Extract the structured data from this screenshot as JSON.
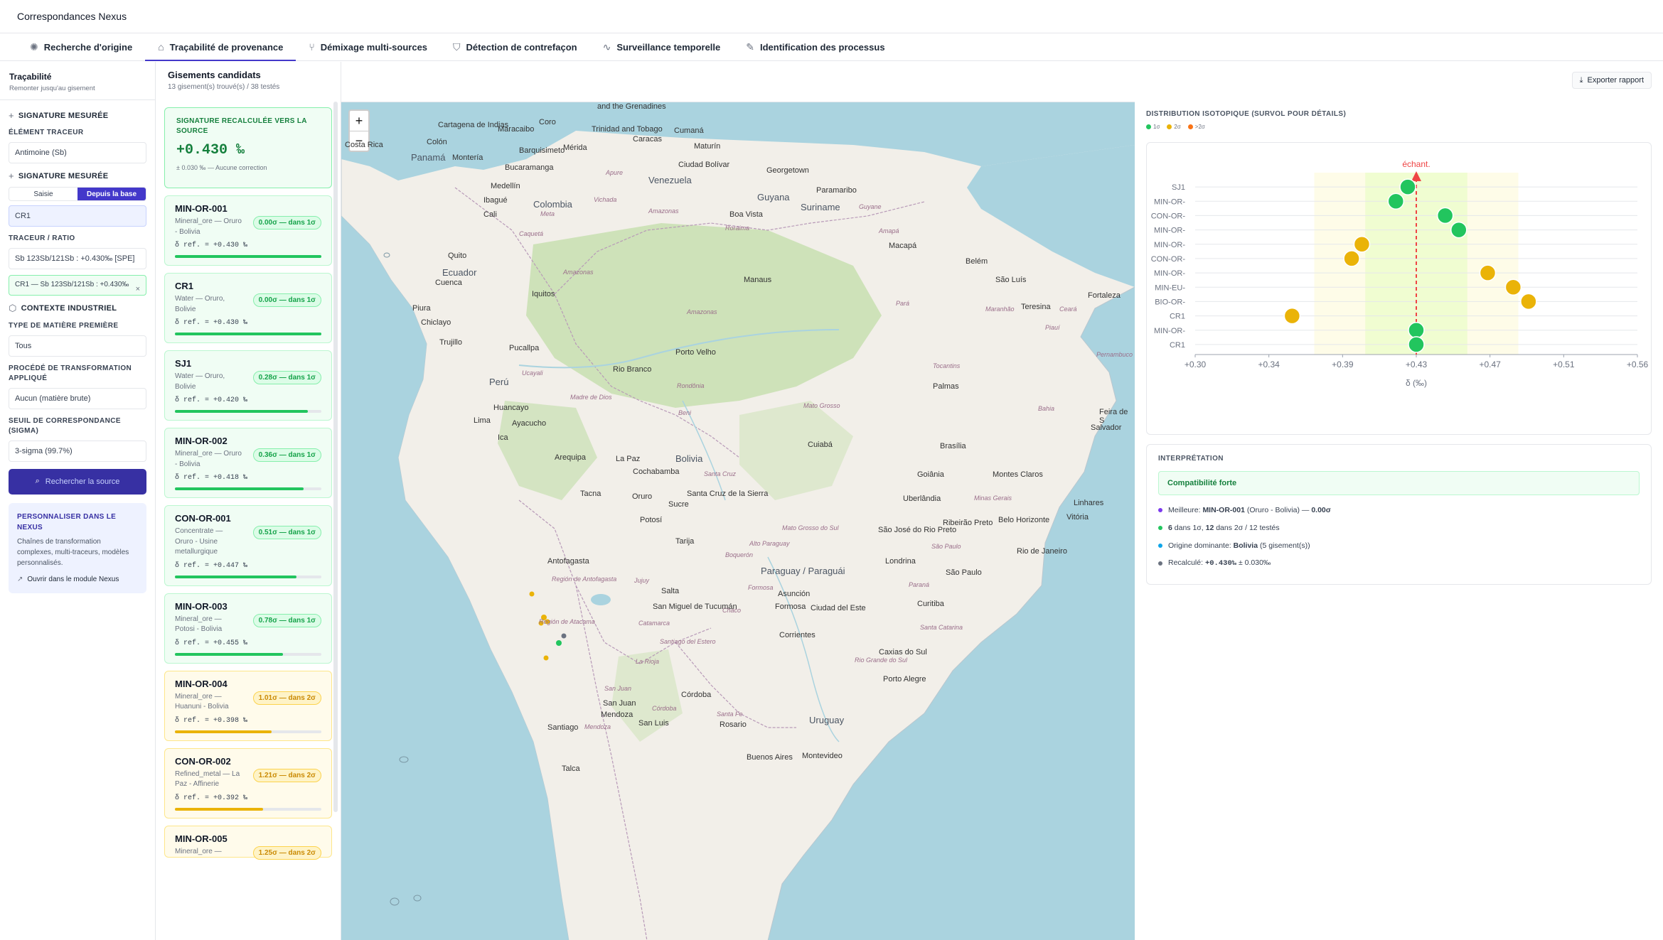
{
  "app": {
    "title": "Correspondances Nexus"
  },
  "tabs": [
    {
      "label": "Recherche d'origine",
      "icon": "sun-icon"
    },
    {
      "label": "Traçabilité de provenance",
      "icon": "home-icon"
    },
    {
      "label": "Démixage multi-sources",
      "icon": "split-icon"
    },
    {
      "label": "Détection de contrefaçon",
      "icon": "shield-icon"
    },
    {
      "label": "Surveillance temporelle",
      "icon": "pulse-icon"
    },
    {
      "label": "Identification des processus",
      "icon": "wrench-icon"
    }
  ],
  "left": {
    "title": "Traçabilité",
    "subtitle": "Remonter jusqu'au gisement",
    "sig1_header": "SIGNATURE MESURÉE",
    "element_label": "ÉLÉMENT TRACEUR",
    "element_value": "Antimoine (Sb)",
    "sig2_header": "SIGNATURE MESURÉE",
    "toggle_manual": "Saisie",
    "toggle_db": "Depuis la base",
    "sample_value": "CR1",
    "ratio_label": "TRACEUR / RATIO",
    "ratio_value": "Sb 123Sb/121Sb : +0.430‰ [SPE]",
    "chip_text": "CR1 — Sb 123Sb/121Sb : +0.430‰",
    "ctx_header": "CONTEXTE INDUSTRIEL",
    "material_label": "TYPE DE MATIÈRE PREMIÈRE",
    "material_value": "Tous",
    "process_label": "PROCÉDÉ DE TRANSFORMATION APPLIQUÉ",
    "process_value": "Aucun (matière brute)",
    "threshold_label": "SEUIL DE CORRESPONDANCE (SIGMA)",
    "threshold_value": "3-sigma (99.7%)",
    "search_button": "Rechercher la source",
    "custom_title": "PERSONNALISER DANS LE NEXUS",
    "custom_text": "Chaînes de transformation complexes, multi-traceurs, modèles personnalisés.",
    "custom_link": "Ouvrir dans le module Nexus"
  },
  "candidates": {
    "title": "Gisements candidats",
    "subtitle": "13 gisement(s) trouvé(s) / 38 testés",
    "signature": {
      "title": "SIGNATURE RECALCULÉE VERS LA SOURCE",
      "value": "+0.430 ‰",
      "sub": "± 0.030 ‰ — Aucune correction"
    },
    "cards": [
      {
        "id": "MIN-OR-001",
        "desc": "Mineral_ore — Oruro - Bolivia",
        "badge": "0.00σ — dans 1σ",
        "ref": "δ ref. = +0.430 ‰",
        "score": 1.0,
        "level": "g"
      },
      {
        "id": "CR1",
        "desc": "Water — Oruro, Bolivie",
        "badge": "0.00σ — dans 1σ",
        "ref": "δ ref. = +0.430 ‰",
        "score": 1.0,
        "level": "g"
      },
      {
        "id": "SJ1",
        "desc": "Water — Oruro, Bolivie",
        "badge": "0.28σ — dans 1σ",
        "ref": "δ ref. = +0.420 ‰",
        "score": 0.91,
        "level": "g"
      },
      {
        "id": "MIN-OR-002",
        "desc": "Mineral_ore — Oruro - Bolivia",
        "badge": "0.36σ — dans 1σ",
        "ref": "δ ref. = +0.418 ‰",
        "score": 0.88,
        "level": "g"
      },
      {
        "id": "CON-OR-001",
        "desc": "Concentrate — Oruro - Usine metallurgique",
        "badge": "0.51σ — dans 1σ",
        "ref": "δ ref. = +0.447 ‰",
        "score": 0.83,
        "level": "g"
      },
      {
        "id": "MIN-OR-003",
        "desc": "Mineral_ore — Potosi - Bolivia",
        "badge": "0.78σ — dans 1σ",
        "ref": "δ ref. = +0.455 ‰",
        "score": 0.74,
        "level": "g"
      },
      {
        "id": "MIN-OR-004",
        "desc": "Mineral_ore — Huanuni - Bolivia",
        "badge": "1.01σ — dans 2σ",
        "ref": "δ ref. = +0.398 ‰",
        "score": 0.66,
        "level": "y"
      },
      {
        "id": "CON-OR-002",
        "desc": "Refined_metal — La Paz - Affinerie",
        "badge": "1.21σ — dans 2σ",
        "ref": "δ ref. = +0.392 ‰",
        "score": 0.6,
        "level": "y"
      },
      {
        "id": "MIN-OR-005",
        "desc": "Mineral_ore —",
        "badge": "1.25σ — dans 2σ",
        "ref": "",
        "score": 0.58,
        "level": "y"
      }
    ]
  },
  "map": {
    "zoom_in": "+",
    "zoom_out": "−",
    "labels": {
      "andgren": "and the Grenadines",
      "trinidad": "Trinidad and Tobago",
      "cartagena": "Cartagena de Indias",
      "maracaibo": "Maracaibo",
      "coro": "Coro",
      "caracas": "Caracas",
      "cumana": "Cumaná",
      "costarica": "Costa Rica",
      "colon": "Colón",
      "panama": "Panamá",
      "monteria": "Montería",
      "barquisimeto": "Barquisimeto",
      "merida": "Mérida",
      "maturin": "Maturín",
      "bucaramanga": "Bucaramanga",
      "apure": "Apure",
      "bolivar": "Ciudad Bolívar",
      "georgetown": "Georgetown",
      "medellin": "Medellín",
      "venezuela": "Venezuela",
      "ibague": "Ibagué",
      "colombia": "Colombia",
      "vichada": "Vichada",
      "paramaribo": "Paramaribo",
      "guyana": "Guyana",
      "suriname": "Suriname",
      "guyane": "Guyane",
      "cali": "Cali",
      "amazonas1": "Amazonas",
      "meta": "Meta",
      "boavista": "Boa Vista",
      "roraima": "Roraima",
      "amapa": "Amapá",
      "macapa": "Macapá",
      "caqueta": "Caquetá",
      "quito": "Quito",
      "belem": "Belém",
      "ecuador": "Ecuador",
      "cuenca": "Cuenca",
      "amazonas2": "Amazonas",
      "manaus": "Manaus",
      "iquitos": "Iquitos",
      "saoluis": "São Luís",
      "fortaleza": "Fortaleza",
      "teresina": "Teresina",
      "piura": "Piura",
      "chiclayo": "Chiclayo",
      "amazonas3": "Amazonas",
      "para": "Pará",
      "maranhao": "Maranhão",
      "ceara": "Ceará",
      "trujillo": "Trujillo",
      "piaui": "Piauí",
      "pucallpa": "Pucallpa",
      "portovelho": "Porto Velho",
      "tocantins": "Tocantins",
      "pernambuco": "Pernambuco",
      "peru": "Perú",
      "ucayali": "Ucayali",
      "riobranco": "Rio Branco",
      "palmas": "Palmas",
      "rondonia": "Rondônia",
      "huancayo": "Huancayo",
      "lima": "Lima",
      "ayacucho": "Ayacucho",
      "madrede": "Madre de Dios",
      "matogrosso": "Mato Grosso",
      "beni": "Beni",
      "bahia": "Bahia",
      "feira": "Feira de S",
      "salvador": "Salvador",
      "ica": "Ica",
      "cuiaba": "Cuiabá",
      "brasilia": "Brasília",
      "arequipa": "Arequipa",
      "lapaz": "La Paz",
      "bolivia": "Bolivia",
      "cochabamba": "Cochabamba",
      "santacruz": "Santa Cruz",
      "santacruz2": "Santa Cruz de la Sierra",
      "goiania": "Goiânia",
      "montesclaros": "Montes Claros",
      "tacna": "Tacna",
      "oruro": "Oruro",
      "sucre": "Sucre",
      "potosi": "Potosí",
      "uberlandia": "Uberlândia",
      "minas": "Minas Gerais",
      "linhares": "Linhares",
      "vitoria": "Vitória",
      "matogrossosul": "Mato Grosso do Sul",
      "ribeiraopreto": "Ribeirão Preto",
      "saojose": "São José do Rio Preto",
      "belohorizonte": "Belo Horizonte",
      "tarija": "Tarija",
      "boqueron": "Boquerón",
      "altoparaguay": "Alto Paraguay",
      "saopaulo1": "São Paulo",
      "riodejaneiro": "Rio de Janeiro",
      "antofagasta": "Antofagasta",
      "regionantofagasta": "Región de Antofagasta",
      "paraguay": "Paraguay / Paraguái",
      "londrina": "Londrina",
      "saopaulo2": "São Paulo",
      "jujuy": "Jujuy",
      "formosa1": "Formosa",
      "asuncion": "Asunción",
      "parana": "Paraná",
      "salta": "Salta",
      "formosa2": "Formosa",
      "cdeleste": "Ciudad del Este",
      "curitiba": "Curitiba",
      "chaco": "Chaco",
      "tucuman": "San Miguel de Tucumán",
      "regionatacama": "Región de Atacama",
      "catamarca": "Catamarca",
      "corrientes": "Corrientes",
      "santacatarina": "Santa Catarina",
      "santiagoestero": "Santiago del Estero",
      "caxias": "Caxias do Sul",
      "riograndesul": "Rio Grande do Sul",
      "portoalegre": "Porto Alegre",
      "larioja": "La Rioja",
      "sanjuan1": "San Juan",
      "cordoba1": "Córdoba",
      "sanjuan2": "San Juan",
      "santafe": "Santa Fe",
      "mendoza1": "Mendoza",
      "sanluis": "San Luis",
      "cordoba2": "Córdoba",
      "rosario": "Rosario",
      "uruguay": "Uruguay",
      "mendoza2": "Mendoza",
      "santiago": "Santiago",
      "buenosaires": "Buenos Aires",
      "montevideo": "Montevideo",
      "talca": "Talca"
    }
  },
  "right": {
    "export_button": "Exporter rapport",
    "dist_title": "DISTRIBUTION ISOTOPIQUE (SURVOL POUR DÉTAILS)",
    "legend": [
      {
        "label": "1σ",
        "color": "#22c55e"
      },
      {
        "label": "2σ",
        "color": "#eab308"
      },
      {
        "label": ">2σ",
        "color": "#f97316"
      }
    ],
    "interp_title": "INTERPRÉTATION",
    "compat": "Compatibilité forte",
    "interp_items": [
      {
        "pre": "Meilleure: ",
        "b1": "MIN-OR-001",
        "mid": " (Oruro - Bolivia) — ",
        "b2": "0.00σ",
        "post": "",
        "color": "#7c3aed"
      },
      {
        "pre": "",
        "b1": "6",
        "mid": " dans 1σ, ",
        "b2": "12",
        "post": " dans 2σ / 12 testés",
        "color": "#22c55e"
      },
      {
        "pre": "Origine dominante: ",
        "b1": "Bolivia",
        "mid": " (5 gisement(s))",
        "b2": "",
        "post": "",
        "color": "#0ea5e9"
      },
      {
        "pre": "Recalculé: ",
        "b1": "+0.430‰",
        "mid": " ± 0.030‰",
        "b2": "",
        "post": "",
        "color": "#6b7280"
      }
    ]
  },
  "chart_data": {
    "type": "scatter",
    "title": "DISTRIBUTION ISOTOPIQUE (SURVOL POUR DÉTAILS)",
    "xlabel": "δ (‰)",
    "ylabel": "",
    "xlim": [
      0.3,
      0.56
    ],
    "x_ticks": [
      "+0.30",
      "+0.34",
      "+0.39",
      "+0.43",
      "+0.47",
      "+0.51",
      "+0.56"
    ],
    "categories": [
      "SJ1",
      "MIN-OR-",
      "CON-OR-",
      "MIN-OR-",
      "MIN-OR-",
      "CON-OR-",
      "MIN-OR-",
      "MIN-EU-",
      "BIO-OR-",
      "CR1",
      "MIN-OR-",
      "CR1"
    ],
    "values": [
      0.425,
      0.418,
      0.447,
      0.455,
      0.398,
      0.392,
      0.472,
      0.487,
      0.496,
      0.357,
      0.43,
      0.43
    ],
    "levels": [
      "1σ",
      "1σ",
      "1σ",
      "1σ",
      "2σ",
      "2σ",
      "2σ",
      "2σ",
      "2σ",
      "2σ",
      "1σ",
      "1σ"
    ],
    "sample_value": 0.43,
    "sample_label": "échant.",
    "band_1sigma": [
      0.4,
      0.46
    ],
    "band_2sigma": [
      0.37,
      0.49
    ],
    "legend": "top-left"
  }
}
